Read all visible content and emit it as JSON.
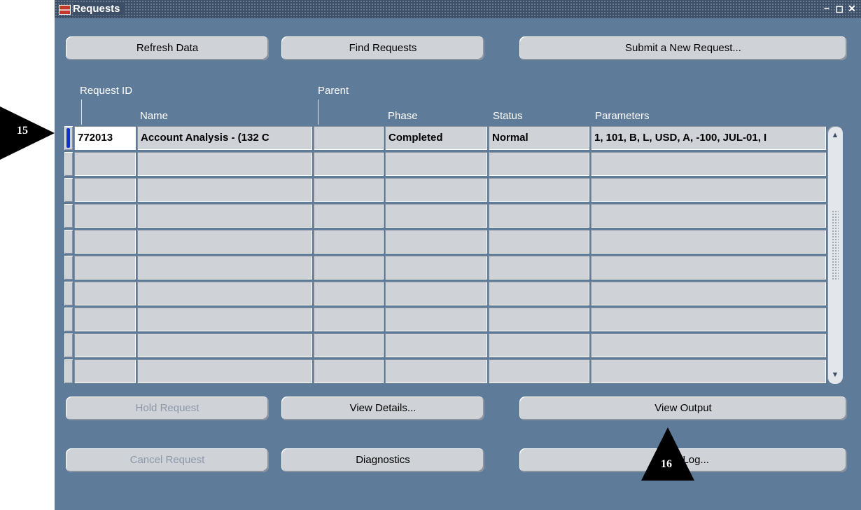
{
  "window": {
    "title": "Requests",
    "controls": [
      "minimize-icon",
      "maximize-icon",
      "close-icon"
    ]
  },
  "buttons": {
    "refresh": "Refresh Data",
    "find": "Find Requests",
    "submit": "Submit a New Request...",
    "hold": "Hold Request",
    "details": "View Details...",
    "output": "View Output",
    "cancel": "Cancel Request",
    "diagnostics": "Diagnostics",
    "log": "View Log..."
  },
  "columns": {
    "request_id": "Request ID",
    "name": "Name",
    "parent": "Parent",
    "phase": "Phase",
    "status": "Status",
    "parameters": "Parameters"
  },
  "rows": [
    {
      "request_id": "772013",
      "name": "Account Analysis - (132 C",
      "parent": "",
      "phase": "Completed",
      "status": "Normal",
      "parameters": "1, 101, B, L, USD, A, -100, JUL-01, I"
    }
  ],
  "callouts": {
    "left": "15",
    "bottom": "16"
  },
  "colors": {
    "window_bg": "#5f7b9a",
    "titlebar": "#3d4f66",
    "field_bg": "#cfd2d7",
    "record_indicator": "#1030d0"
  }
}
